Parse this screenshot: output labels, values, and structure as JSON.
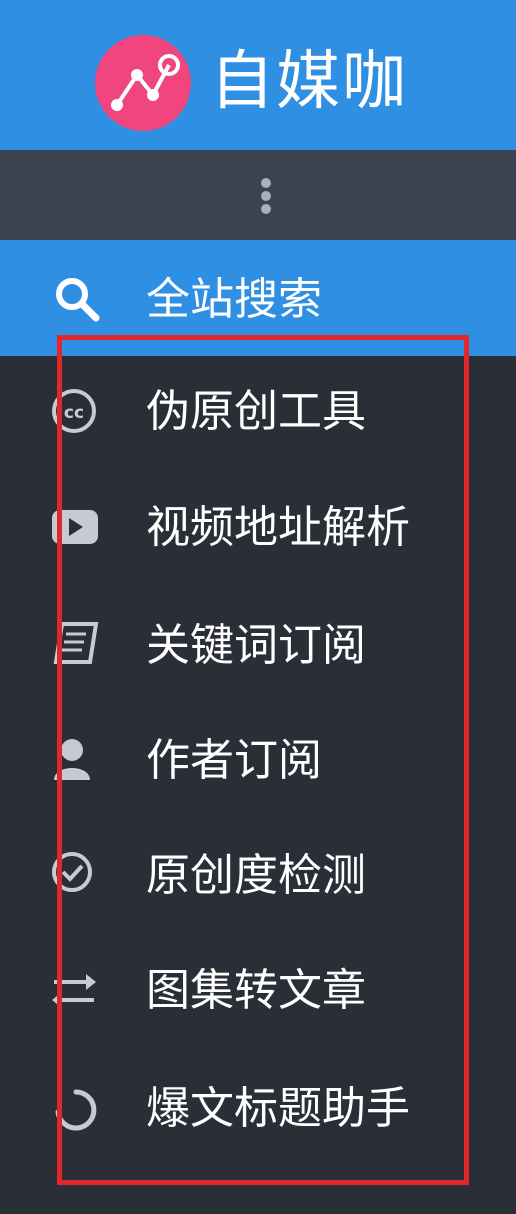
{
  "header": {
    "brand_name": "自媒咖",
    "logo_icon": "graph-nodes-logo-icon",
    "brand_color": "#2f8fe3",
    "logo_color": "#f0457d"
  },
  "more_bar": {
    "icon": "vertical-ellipsis-icon"
  },
  "menu": {
    "items": [
      {
        "label": "全站搜索",
        "icon": "search-icon",
        "active": true
      },
      {
        "label": "伪原创工具",
        "icon": "cc-icon",
        "active": false
      },
      {
        "label": "视频地址解析",
        "icon": "video-play-icon",
        "active": false
      },
      {
        "label": "关键词订阅",
        "icon": "notebook-icon",
        "active": false
      },
      {
        "label": "作者订阅",
        "icon": "user-icon",
        "active": false
      },
      {
        "label": "原创度检测",
        "icon": "check-circle-icon",
        "active": false
      },
      {
        "label": "图集转文章",
        "icon": "exchange-arrows-icon",
        "active": false
      },
      {
        "label": "爆文标题助手",
        "icon": "spinner-icon",
        "active": false
      }
    ]
  },
  "annotation": {
    "highlight_color": "#e3262c"
  }
}
